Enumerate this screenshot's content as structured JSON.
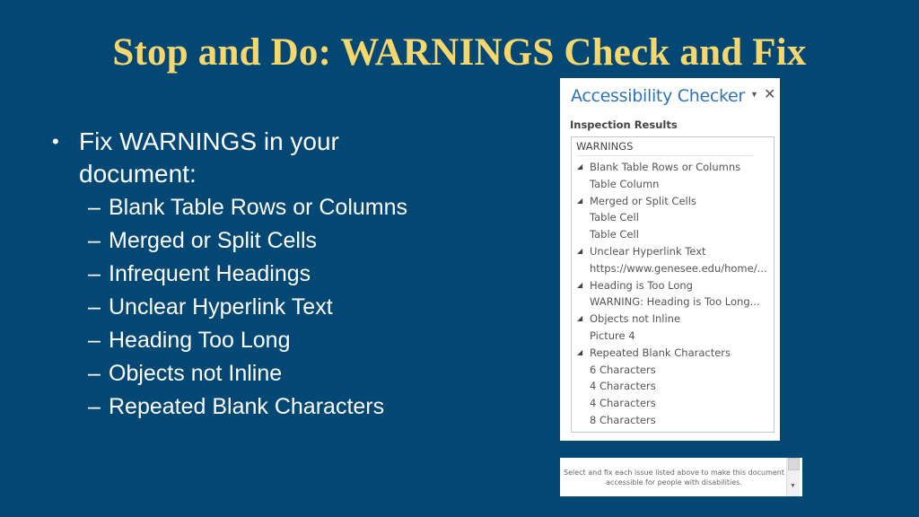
{
  "slide": {
    "title": "Stop and Do: WARNINGS Check and Fix",
    "title_color": "#f5d76e",
    "background_color": "#034875",
    "bullet": {
      "marker": "•",
      "text": "Fix WARNINGS in your document:",
      "sub_marker": "–",
      "sub_items": [
        "Blank Table Rows or Columns",
        "Merged or Split Cells",
        "Infrequent Headings",
        "Unclear Hyperlink Text",
        "Heading Too Long",
        "Objects not Inline",
        "Repeated Blank Characters"
      ]
    }
  },
  "checker": {
    "title": "Accessibility Checker",
    "title_color": "#2e74b5",
    "dropdown_icon": "▼",
    "close_icon": "✕",
    "section_label": "Inspection Results",
    "results_header": "WARNINGS",
    "expand_icon": "◢",
    "categories": [
      {
        "label": "Blank Table Rows or Columns",
        "children": [
          "Table Column"
        ]
      },
      {
        "label": "Merged or Split Cells",
        "children": [
          "Table Cell",
          "Table Cell"
        ]
      },
      {
        "label": "Unclear Hyperlink Text",
        "children": [
          "https://www.genesee.edu/home/..."
        ]
      },
      {
        "label": "Heading is Too Long",
        "children": [
          "WARNING: Heading is Too Long..."
        ]
      },
      {
        "label": "Objects not Inline",
        "children": [
          "Picture 4"
        ]
      },
      {
        "label": "Repeated Blank Characters",
        "children": [
          "6 Characters",
          "4 Characters",
          "4 Characters",
          "8 Characters"
        ]
      }
    ],
    "footer_text": "Select and fix each issue listed above to make this document accessible for people with disabilities.",
    "scroll_down_icon": "▼"
  }
}
